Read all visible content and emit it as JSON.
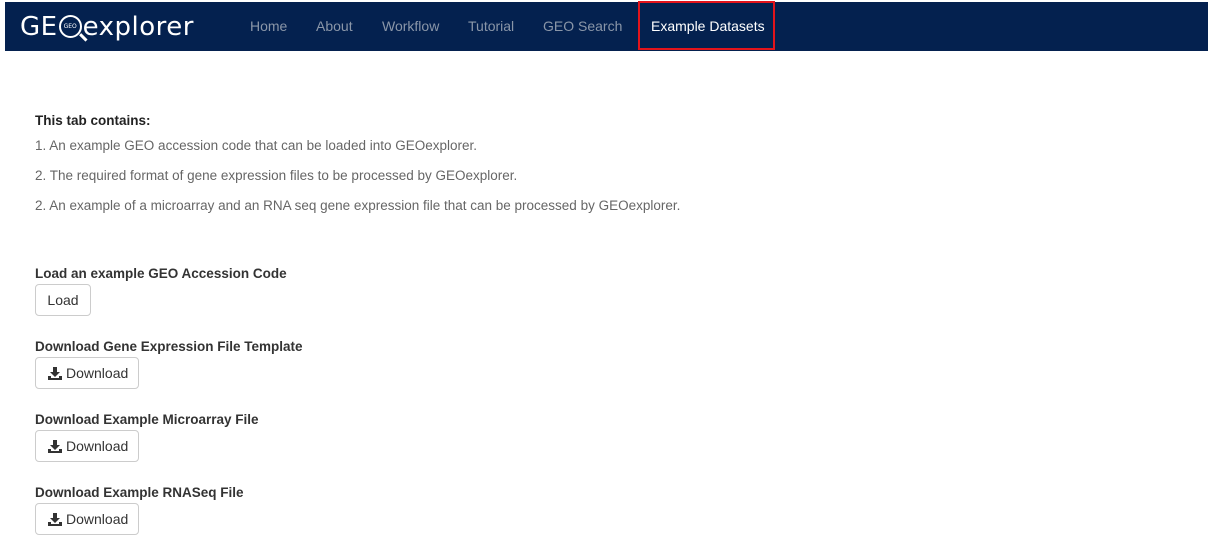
{
  "brand": {
    "prefix": "GE",
    "mini_text": "GEO",
    "suffix": "explorer"
  },
  "nav": {
    "items": [
      {
        "label": "Home",
        "active": false
      },
      {
        "label": "About",
        "active": false
      },
      {
        "label": "Workflow",
        "active": false
      },
      {
        "label": "Tutorial",
        "active": false
      },
      {
        "label": "GEO Search",
        "active": false
      },
      {
        "label": "Example Datasets",
        "active": true
      }
    ]
  },
  "intro": {
    "heading": "This tab contains:",
    "lines": [
      "1. An example GEO accession code that can be loaded into GEOexplorer.",
      "2. The required format of gene expression files to be processed by GEOexplorer.",
      "2. An example of a microarray and an RNA seq gene expression file that can be processed by GEOexplorer."
    ]
  },
  "sections": {
    "load": {
      "label": "Load an example GEO Accession Code",
      "button": "Load"
    },
    "template": {
      "label": "Download Gene Expression File Template",
      "button": "Download"
    },
    "microarray": {
      "label": "Download Example Microarray File",
      "button": "Download"
    },
    "rnaseq": {
      "label": "Download Example RNASeq File",
      "button": "Download"
    }
  },
  "colors": {
    "navbar_bg": "#04214f",
    "nav_inactive": "#8a96a8",
    "nav_active": "#ffffff",
    "highlight": "#e3141b"
  }
}
